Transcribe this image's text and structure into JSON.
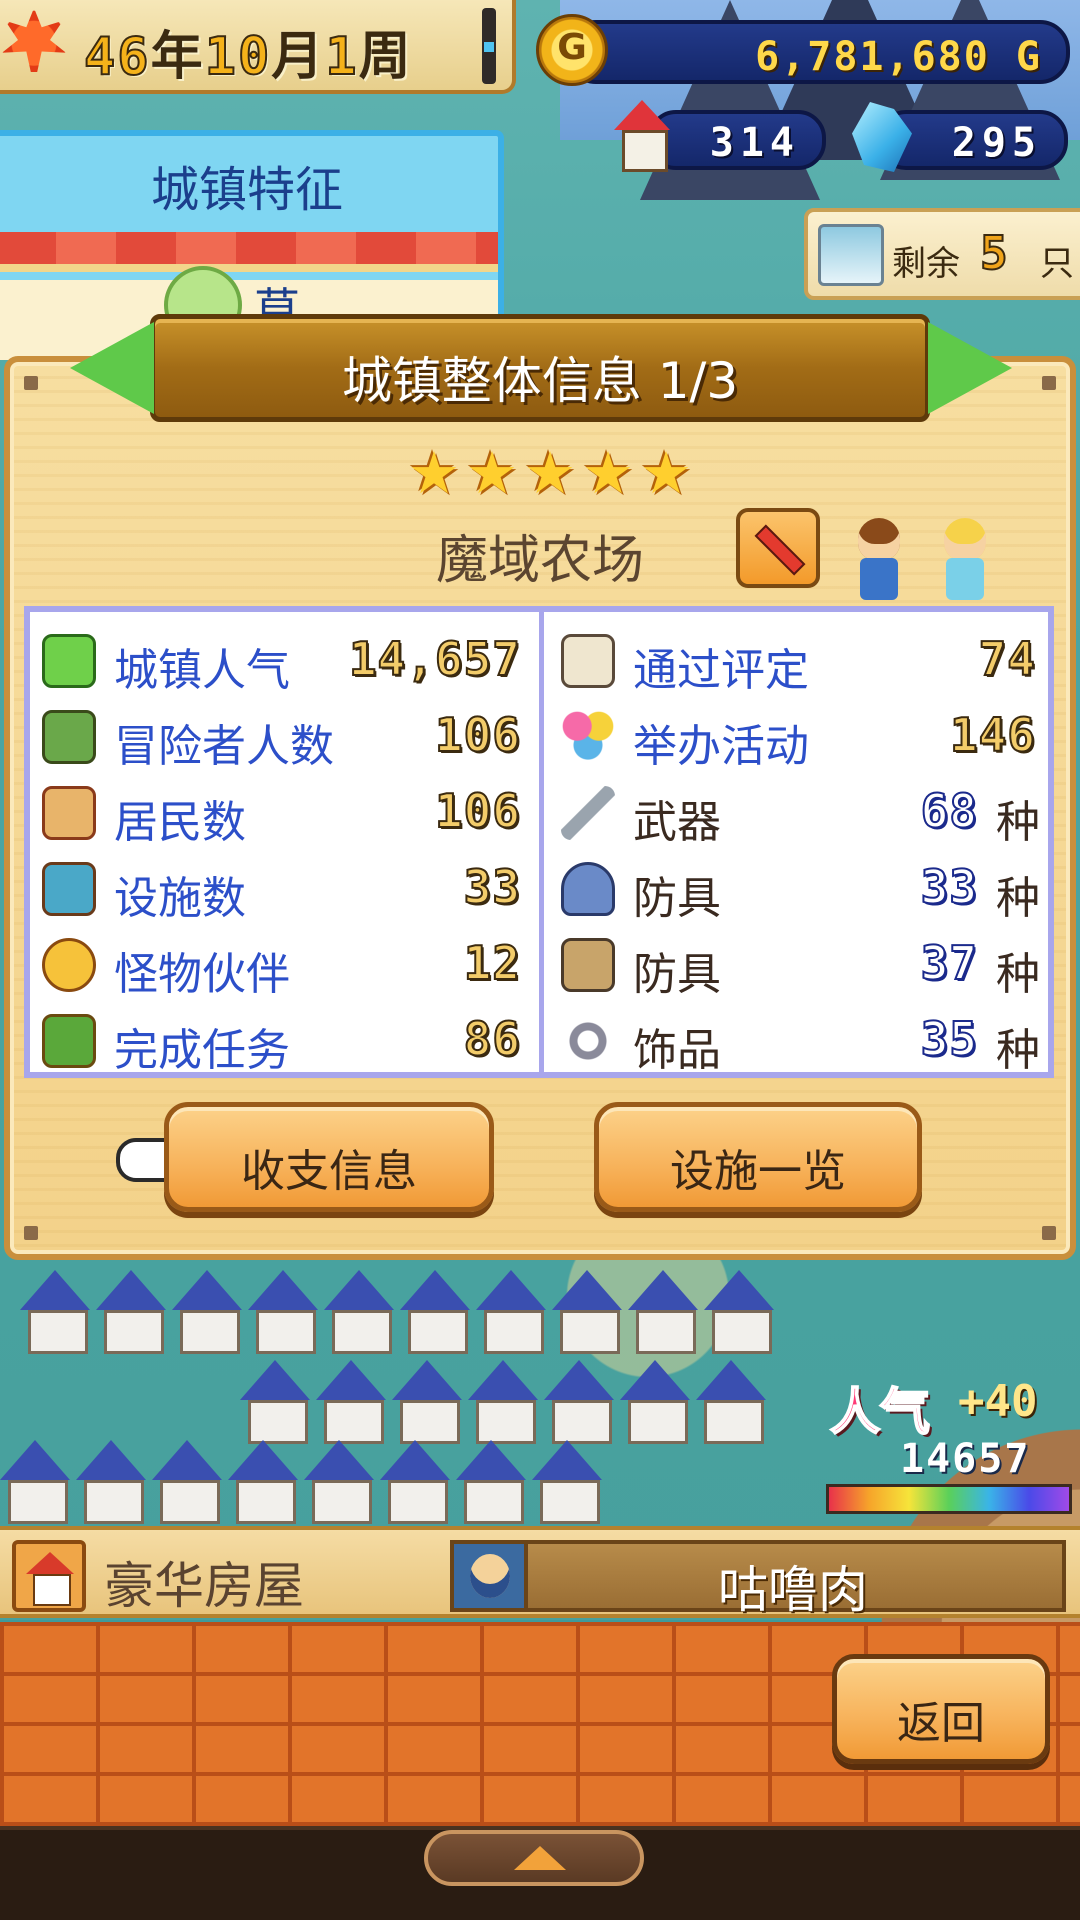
{
  "hud": {
    "date_year": "46",
    "date_year_unit": "年",
    "date_month": "10",
    "date_month_unit": "月",
    "date_week": "1",
    "date_week_unit": "周",
    "money": "6,781,680 G",
    "coin_letter": "G",
    "houses": "314",
    "crystals": "295",
    "remain_label": "剩余",
    "remain_count": "5",
    "remain_unit": "只"
  },
  "feature_panel": {
    "title": "城镇特征",
    "item_partial": "草"
  },
  "dialog": {
    "title": "城镇整体信息 1/3",
    "stars": 5,
    "town_name": "魔域农场",
    "left_stats": [
      {
        "label": "城镇人气",
        "value": "14,657",
        "icon": "trophy-icon"
      },
      {
        "label": "冒险者人数",
        "value": "106",
        "icon": "adventurer-icon"
      },
      {
        "label": "居民数",
        "value": "106",
        "icon": "house-icon"
      },
      {
        "label": "设施数",
        "value": "33",
        "icon": "facility-icon"
      },
      {
        "label": "怪物伙伴",
        "value": "12",
        "icon": "monster-icon"
      },
      {
        "label": "完成任务",
        "value": "86",
        "icon": "quest-icon"
      }
    ],
    "right_stats": [
      {
        "label": "通过评定",
        "value": "74",
        "unit": "",
        "icon": "certificate-icon"
      },
      {
        "label": "举办活动",
        "value": "146",
        "unit": "",
        "icon": "balloon-icon"
      },
      {
        "label": "武器",
        "value": "68",
        "unit": "种",
        "icon": "sword-icon"
      },
      {
        "label": "防具",
        "value": "33",
        "unit": "种",
        "icon": "helmet-icon"
      },
      {
        "label": "防具",
        "value": "37",
        "unit": "种",
        "icon": "armor-icon"
      },
      {
        "label": "饰品",
        "value": "35",
        "unit": "种",
        "icon": "ring-icon"
      }
    ],
    "button_finance": "收支信息",
    "button_facilities": "设施一览"
  },
  "popularity": {
    "label": "人气",
    "delta": "+40",
    "value": "14657"
  },
  "status_bar": {
    "left": "豪华房屋",
    "right": "咕噜肉"
  },
  "return_button": "返回"
}
